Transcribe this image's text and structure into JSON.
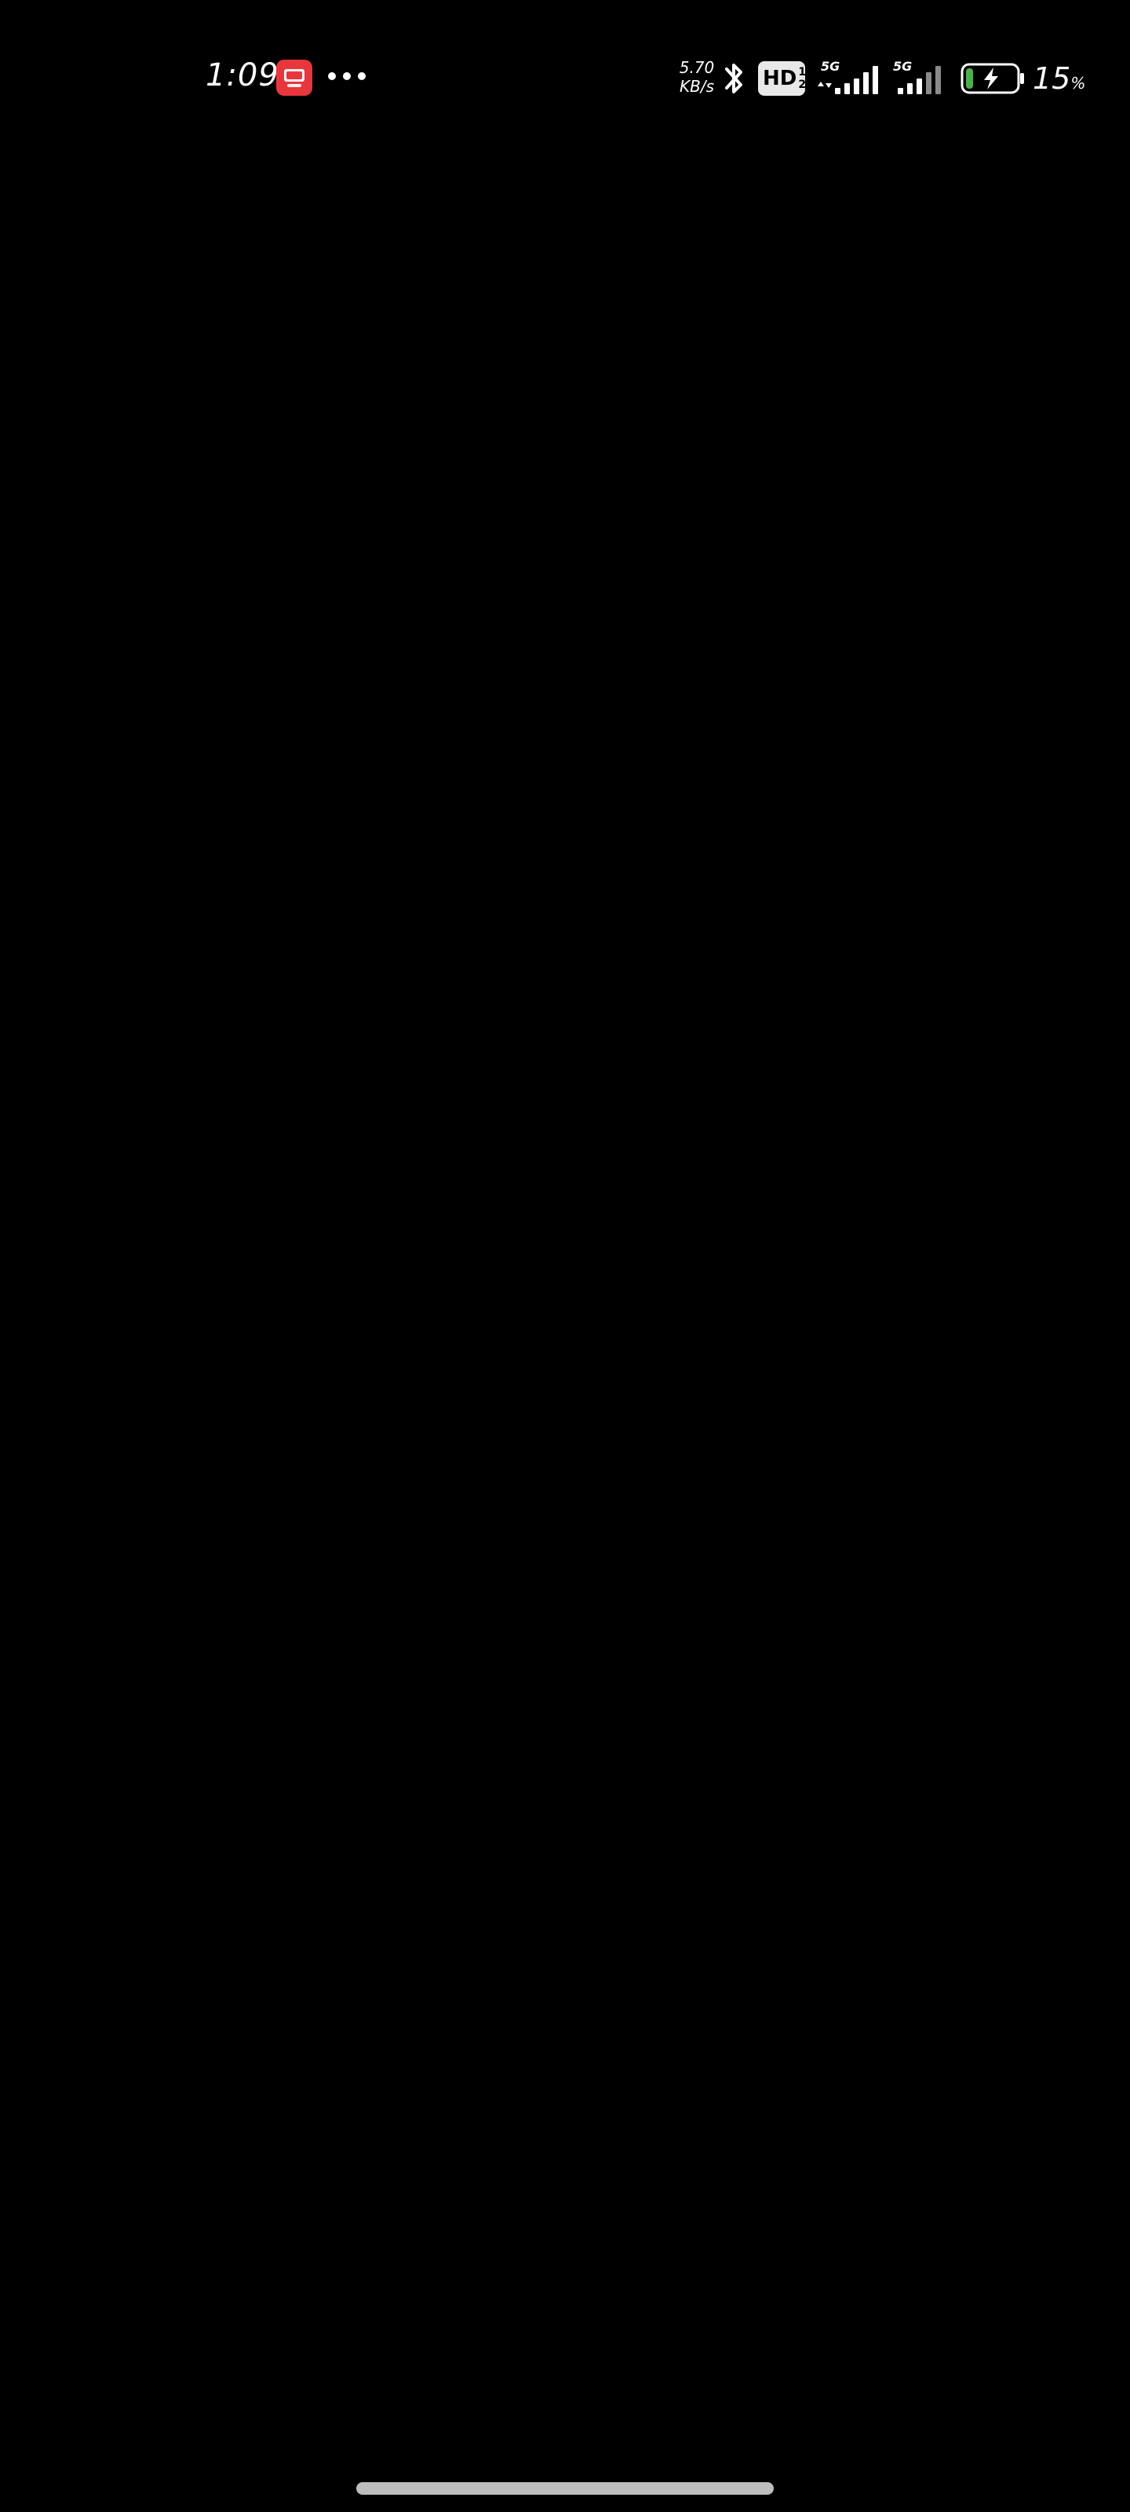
{
  "status_bar": {
    "time": "1:09",
    "notification_app_icon": "red-app-icon",
    "more_indicator": "more-dots-icon",
    "net_speed_value": "5.70",
    "net_speed_unit": "KB/s",
    "bluetooth_icon": "bluetooth-icon",
    "hd_label": "HD",
    "hd_sup_top": "1",
    "hd_sup_bottom": "2",
    "sim1_gen": "5G",
    "sim2_gen": "5G",
    "battery_percent": "15",
    "battery_percent_sign": "%",
    "battery_level": 0.15,
    "battery_charging": true,
    "colors": {
      "background": "#000000",
      "battery_fill": "#4caf50",
      "app_icon": "#e8363d"
    }
  },
  "navigation": {
    "home_indicator": "home-indicator-bar"
  }
}
